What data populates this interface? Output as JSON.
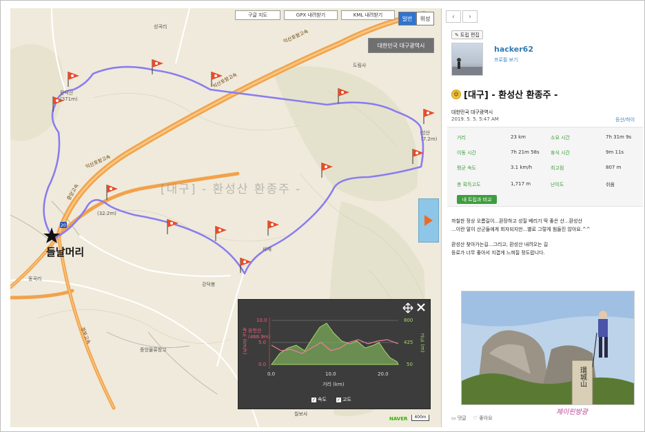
{
  "map": {
    "buttons": [
      "구글 지도",
      "GPX 내려받기",
      "KML 내려받기"
    ],
    "type_buttons": {
      "normal": "일반",
      "satellite": "위성"
    },
    "region_label": "대한민국 대구광역시",
    "watermark": "[대구] - 환성산 환종주 -",
    "start_label": "들날머리",
    "places": {
      "p1": "성곡리",
      "p2": "도림사",
      "p3": "문덕산\n(371m)",
      "p4": "(32.2m)",
      "p5": "강덕봉",
      "p6": "중앙물류창고",
      "p7": "칠보사",
      "p8": "성산\n(7.2m)",
      "p9": "동곡리",
      "p10": "싸재"
    },
    "roads": [
      "익산포항고속",
      "익산포항고속",
      "익산포항고속",
      "중앙고속",
      "경부고속"
    ],
    "colors": {
      "track": "#8a7cf0",
      "road": "#f09a3e",
      "flag": "#e84c2a"
    },
    "elevation": {
      "y_left_ticks": [
        "10.0",
        "5.0",
        "0.0"
      ],
      "y_right_ticks": [
        "800",
        "425",
        "50"
      ],
      "x_ticks": [
        "0.0",
        "10.0",
        "20.0"
      ],
      "x_label": "거리 (km)",
      "y_left_label": "속도 (km/h)",
      "y_right_label": "고도 (m)",
      "point_label": "응천산\n(468.9m)",
      "checks": [
        "속도",
        "고도"
      ]
    },
    "naver": "NAVER",
    "scale": "400m"
  },
  "side": {
    "edit_label": "트립 편집",
    "username": "hacker62",
    "profile_link": "프로필 보기",
    "title": "[대구] - 환성산 환종주 -",
    "region": "대한민국 대구광역시",
    "date": "2019. 5. 5. 5:47 AM",
    "activity": "등산/하이",
    "stats": [
      {
        "label": "거리",
        "value": "23 km"
      },
      {
        "label": "소요 시간",
        "value": "7h 31m 9s"
      },
      {
        "label": "이동 시간",
        "value": "7h 21m 58s"
      },
      {
        "label": "휴식 시간",
        "value": "9m 11s"
      },
      {
        "label": "평균 속도",
        "value": "3.1 km/h"
      },
      {
        "label": "최고점",
        "value": "807 m"
      },
      {
        "label": "총 획득고도",
        "value": "1,717 m"
      },
      {
        "label": "난이도",
        "value": "쉬움"
      }
    ],
    "compare_btn": "내 트립과 비교",
    "desc": [
      "까칠한 정상 오름길이...환장하고 성질 베리기 딱 좋은 산...환성산",
      "...이란 말이 산군들에게 회자되지만...별로 그렇게 힘들진 않아요.^^",
      "",
      "환성산 찾아가는길...그리고, 환성산 내려오는 길",
      "등로가 너무 좋아서 지겹게 느껴질 정도랍니다."
    ],
    "photo_sign": "環城山",
    "footer": {
      "comment": "댓글",
      "like": "좋아요"
    }
  },
  "corner_logo": "제이핀방광"
}
